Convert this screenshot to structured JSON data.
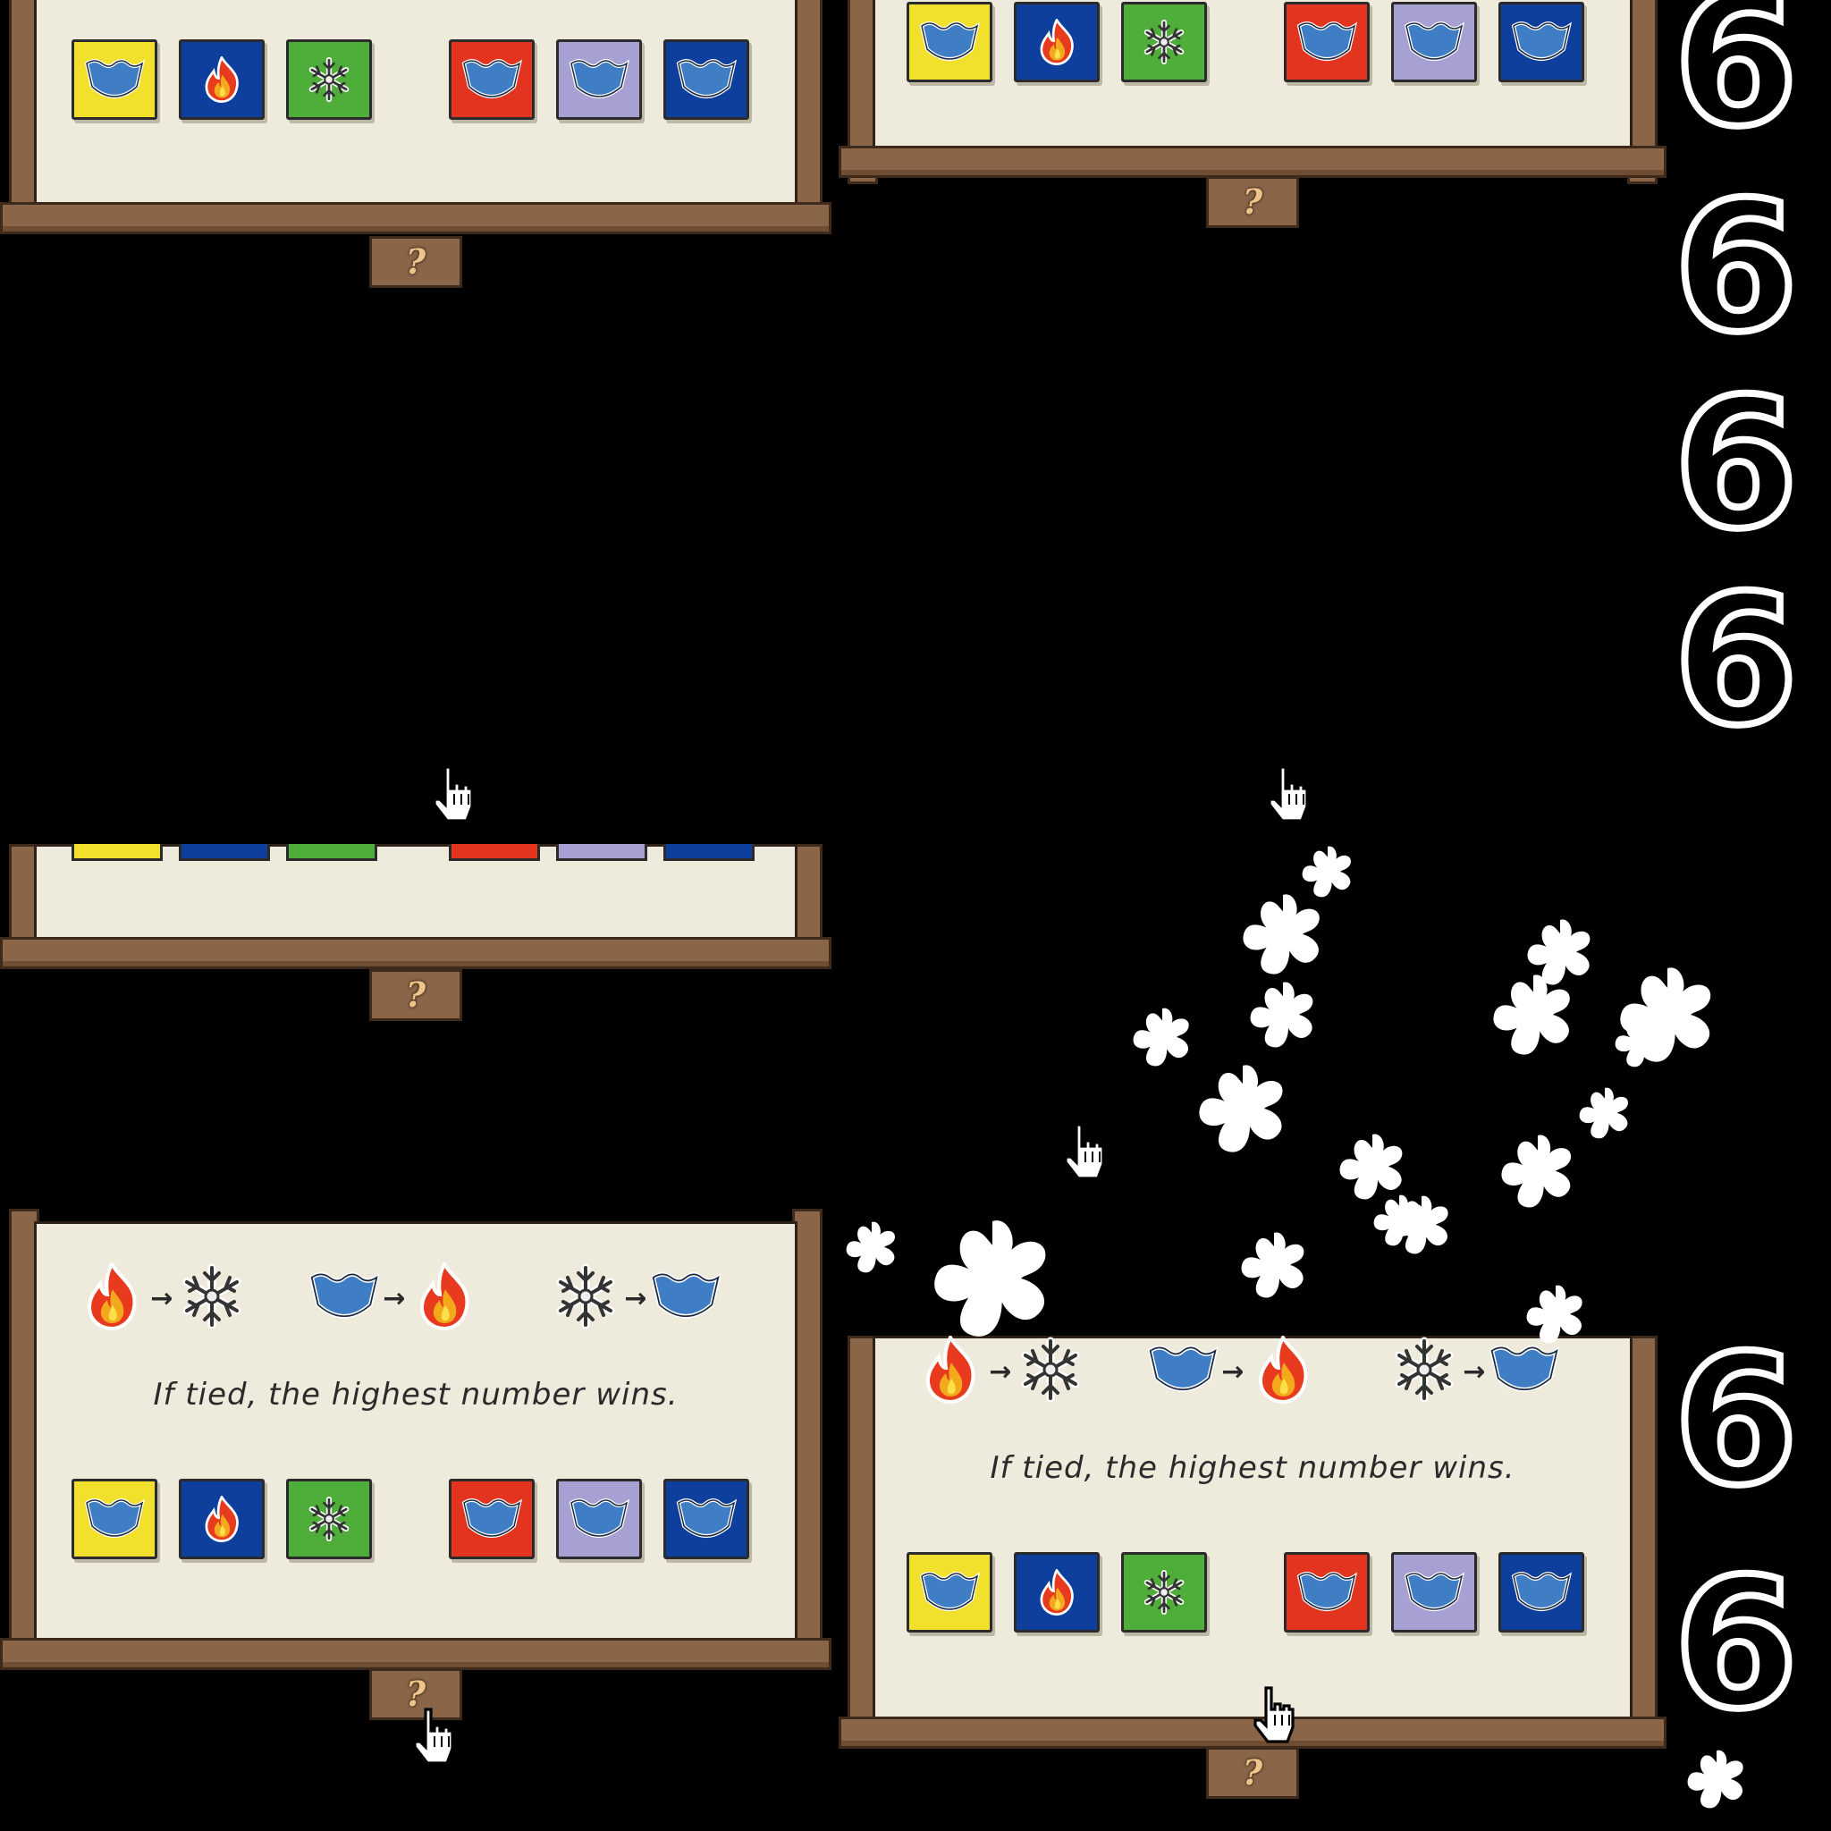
{
  "rules": {
    "tie_text": "If tied, the highest number wins.",
    "help_label": "?",
    "beats": [
      {
        "winner": "fire",
        "loser": "snow"
      },
      {
        "winner": "water",
        "loser": "fire"
      },
      {
        "winner": "snow",
        "loser": "water"
      }
    ]
  },
  "tiles": [
    {
      "color": "#f1e12c",
      "element": "water"
    },
    {
      "color": "#0e3f9c",
      "element": "fire"
    },
    {
      "color": "#4fae3a",
      "element": "snow"
    },
    {
      "color": "#e2341f",
      "element": "water"
    },
    {
      "color": "#a7a0d2",
      "element": "water"
    },
    {
      "color": "#0e3f9c",
      "element": "water"
    }
  ],
  "score": {
    "digit": "6"
  }
}
